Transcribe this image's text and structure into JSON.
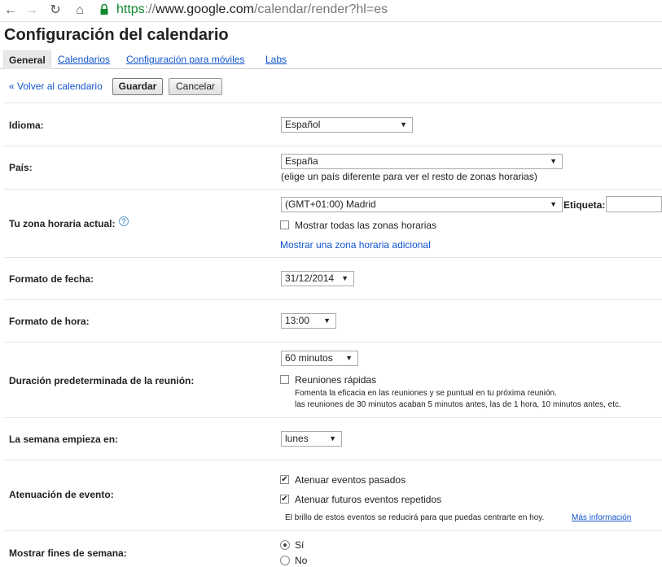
{
  "browser": {
    "url_scheme": "https",
    "url_sep": "://",
    "url_host": "www.google.com",
    "url_path": "/calendar/render?hl=es",
    "icons": [
      "back-icon",
      "forward-icon",
      "reload-icon",
      "home-icon",
      "lock-icon"
    ]
  },
  "page": {
    "title": "Configuración del calendario"
  },
  "tabs": [
    {
      "label": "General",
      "active": true
    },
    {
      "label": "Calendarios",
      "active": false
    },
    {
      "label": "Configuración para móviles",
      "active": false
    },
    {
      "label": "Labs",
      "active": false
    }
  ],
  "actions": {
    "back_label": "« Volver al calendario",
    "save_label": "Guardar",
    "cancel_label": "Cancelar"
  },
  "settings": {
    "language": {
      "label": "Idioma:",
      "value": "Español"
    },
    "country": {
      "label": "País:",
      "value": "España",
      "hint": "(elige un país diferente para ver el resto de zonas horarias)"
    },
    "timezone": {
      "label": "Tu zona horaria actual:",
      "value": "(GMT+01:00) Madrid",
      "tag_label": "Etiqueta:",
      "tag_value": "",
      "show_all_label": "Mostrar todas las zonas horarias",
      "show_all_checked": false,
      "add_link": "Mostrar una zona horaria adicional"
    },
    "date_format": {
      "label": "Formato de fecha:",
      "value": "31/12/2014"
    },
    "time_format": {
      "label": "Formato de hora:",
      "value": "13:00"
    },
    "meeting_duration": {
      "label": "Duración predeterminada de la reunión:",
      "value": "60 minutos",
      "speedy_label": "Reuniones rápidas",
      "speedy_checked": false,
      "speedy_desc_1": "Fomenta la eficacia en las reuniones y se puntual en tu próxima reunión.",
      "speedy_desc_2": "las reuniones de 30 minutos acaban 5 minutos antes, las de 1 hora, 10 minutos antes, etc."
    },
    "week_start": {
      "label": "La semana empieza en:",
      "value": "lunes"
    },
    "event_dimming": {
      "label": "Atenuación de evento:",
      "past_label": "Atenuar eventos pasados",
      "past_checked": true,
      "future_label": "Atenuar futuros eventos repetidos",
      "future_checked": true,
      "note": "El brillo de estos eventos se reducirá para que puedas centrarte en hoy.",
      "more_link": "Más información"
    },
    "weekends": {
      "label": "Mostrar fines de semana:",
      "yes_label": "Sí",
      "no_label": "No",
      "selected": "Sí"
    }
  }
}
